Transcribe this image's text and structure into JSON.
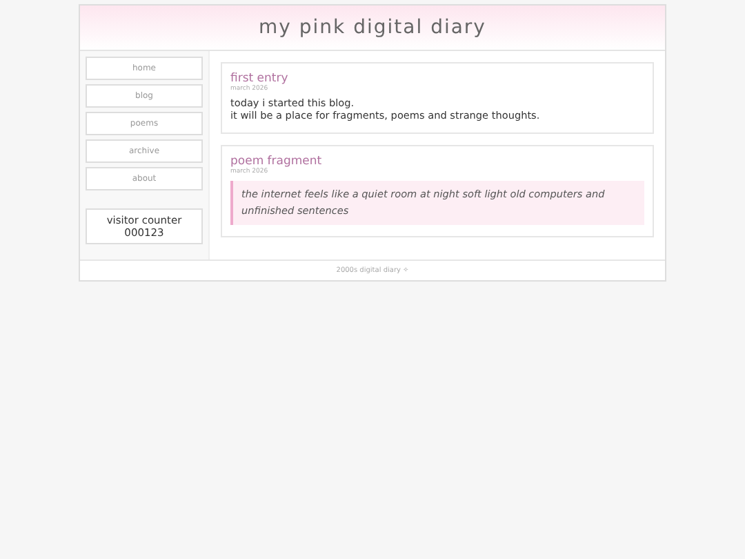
{
  "header": {
    "title": "my pink digital diary"
  },
  "sidebar": {
    "nav": [
      "home",
      "blog",
      "poems",
      "archive",
      "about"
    ],
    "counter": {
      "label": "visitor counter",
      "value": "000123"
    }
  },
  "posts": [
    {
      "kind": "text",
      "title": "first entry",
      "date": "march 2026",
      "lines": [
        "today i started this blog.",
        "it will be a place for fragments, poems and strange thoughts."
      ]
    },
    {
      "kind": "poem",
      "title": "poem fragment",
      "date": "march 2026",
      "lines": [
        "the internet feels like a quiet room at night soft light old computers and unfinished sentences"
      ]
    }
  ],
  "footer": "2000s digital diary ✧"
}
